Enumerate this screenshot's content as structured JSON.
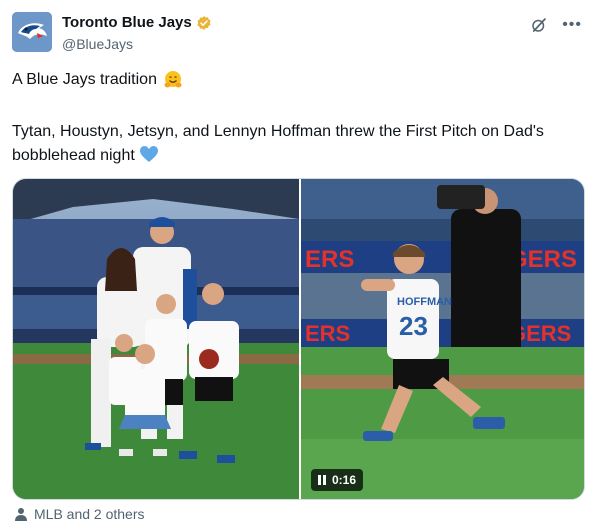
{
  "account": {
    "display_name": "Toronto Blue Jays",
    "handle": "@BlueJays",
    "verified": true,
    "avatar_icon": "blue-jays-logo",
    "badge_color": "#e8b53a"
  },
  "post": {
    "line1": "A Blue Jays tradition",
    "line1_emoji": "hugging-face-emoji",
    "line2": "Tytan, Houstyn, Jetsyn, and Lennyn Hoffman threw the First Pitch on Dad's bobblehead night",
    "line2_emoji": "blue-heart-emoji"
  },
  "media": {
    "photo_icon": "family-photo",
    "video_icon": "first-pitch-video",
    "video_duration": "0:16",
    "jersey_number": "23",
    "jersey_name": "HOFFMAN"
  },
  "tagged": {
    "icon": "person-icon",
    "label": "MLB and 2 others"
  },
  "colors": {
    "accent": "#1d9bf0",
    "text": "#0f1419",
    "muted": "#536471"
  }
}
